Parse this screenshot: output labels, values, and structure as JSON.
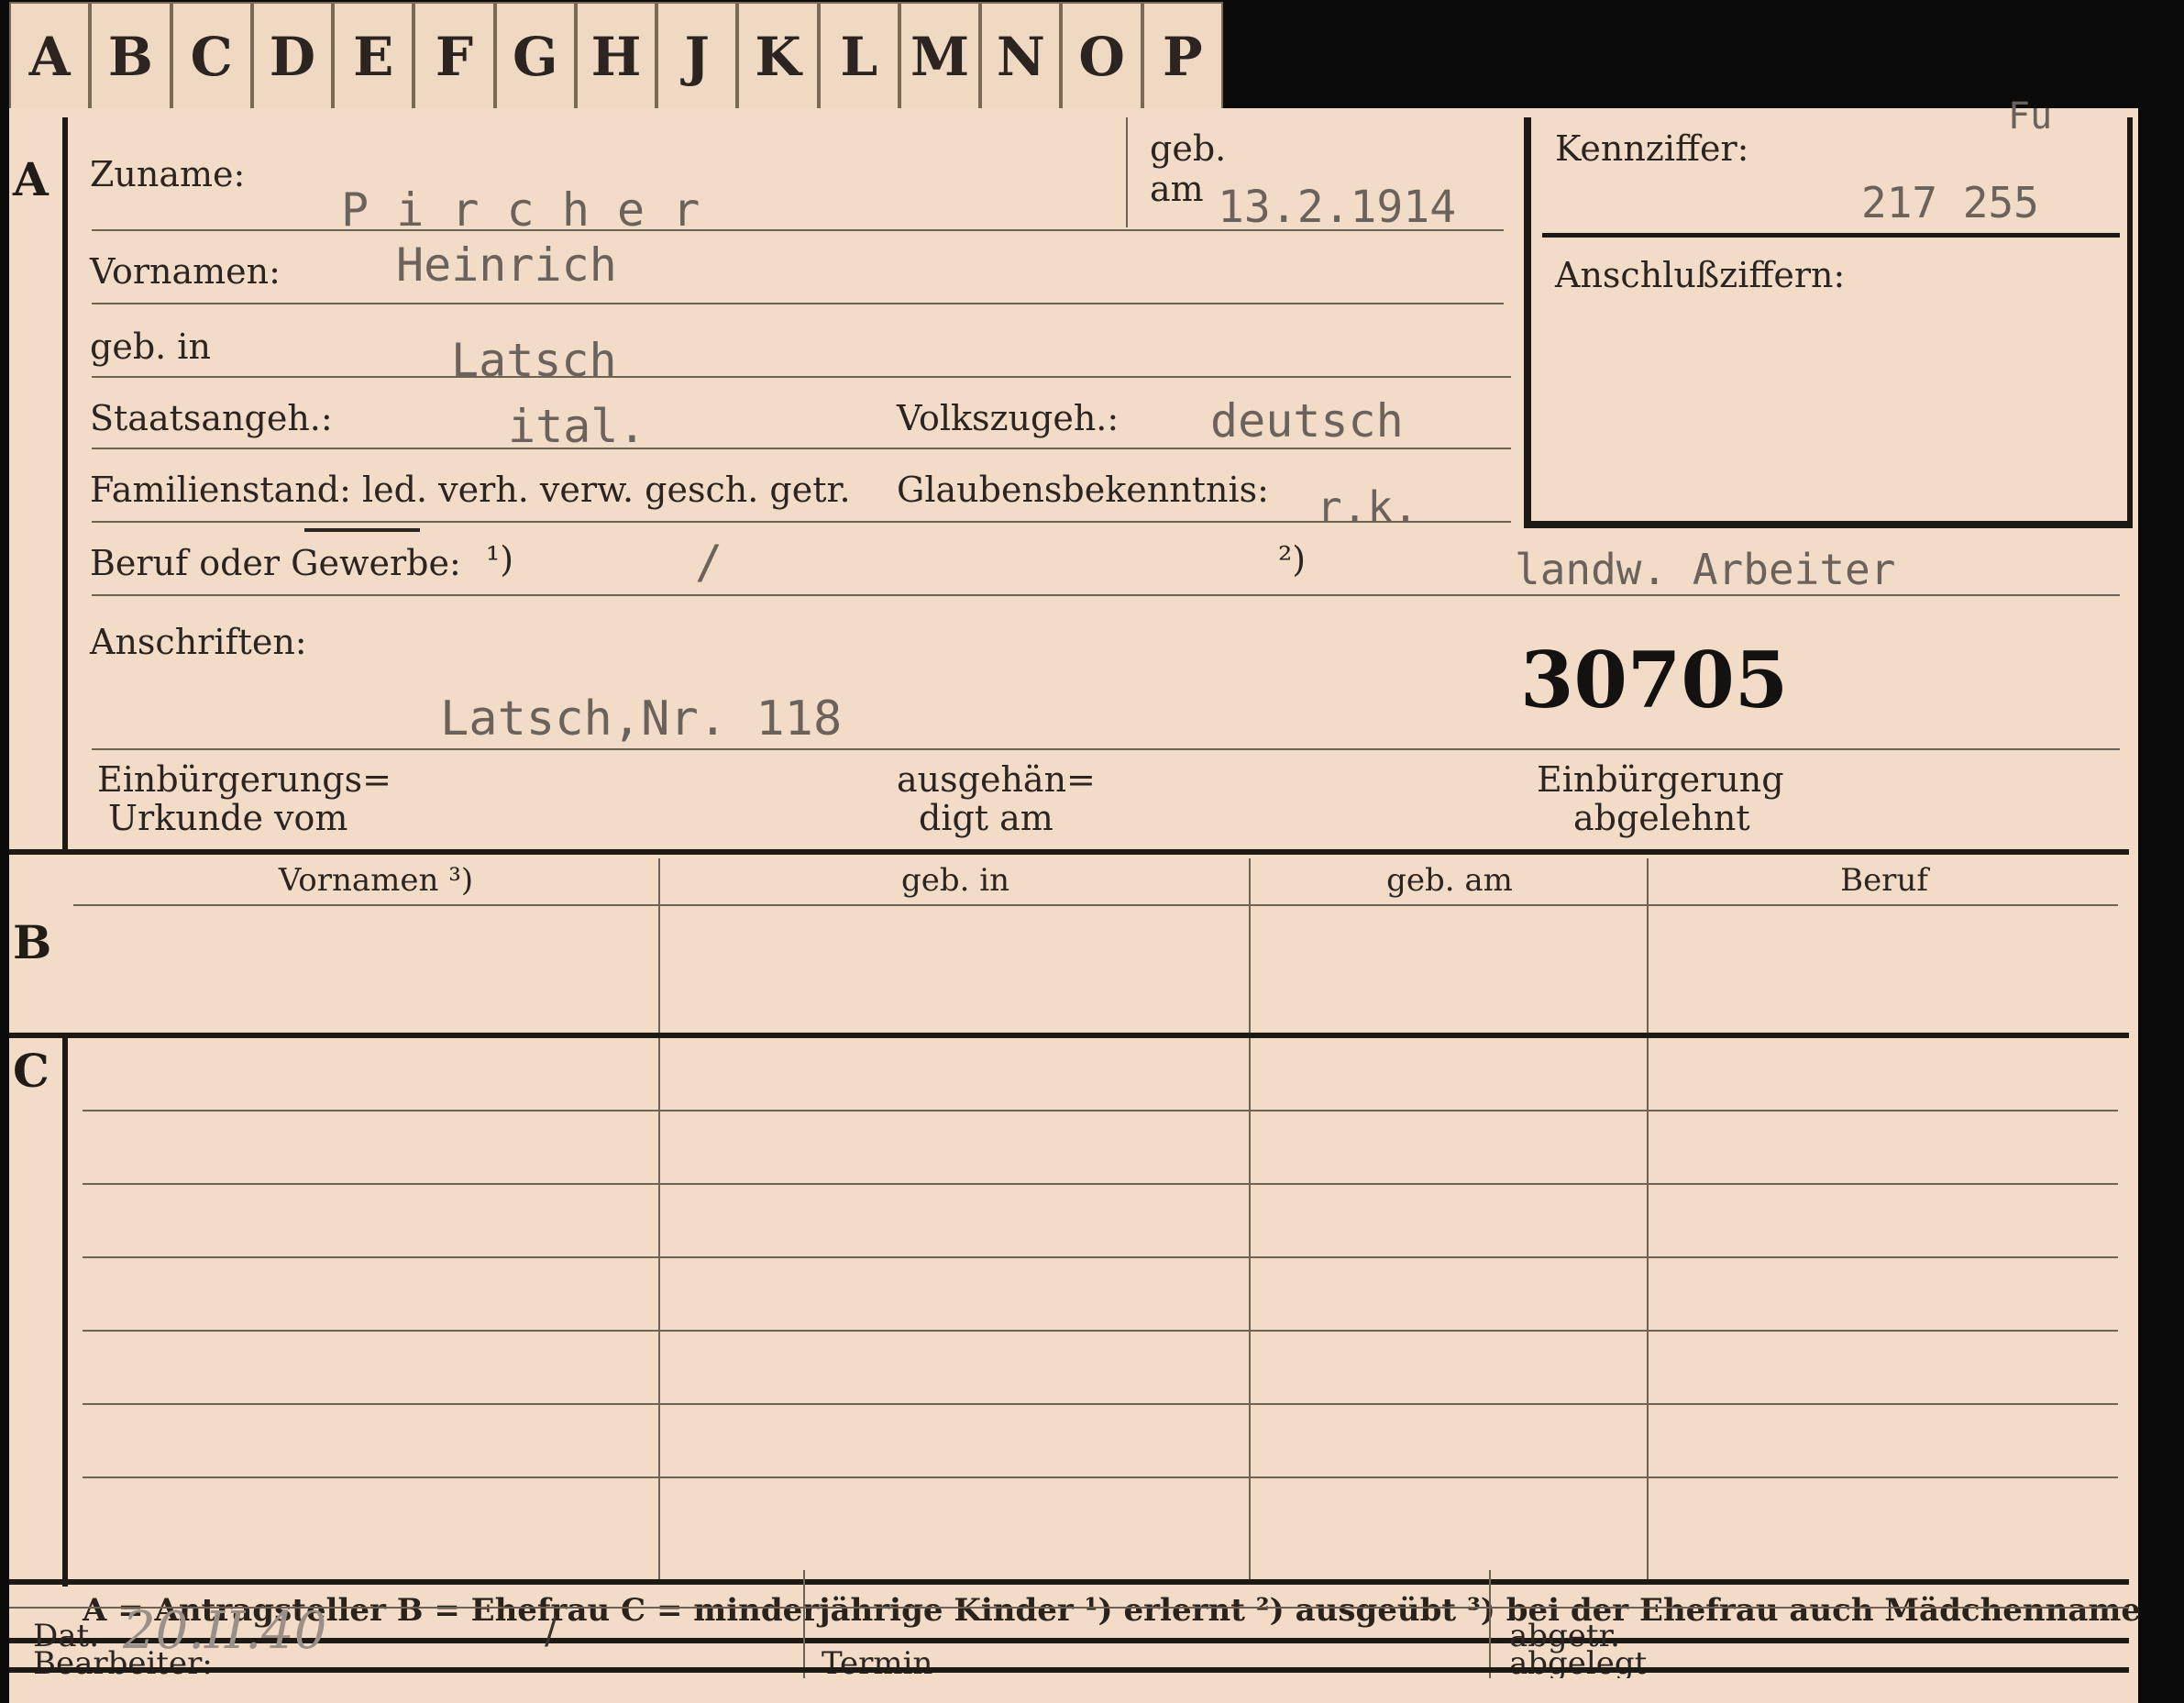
{
  "tabs": [
    "A",
    "B",
    "C",
    "D",
    "E",
    "F",
    "G",
    "H",
    "J",
    "K",
    "L",
    "M",
    "N",
    "O",
    "P"
  ],
  "section_letters": {
    "a": "A",
    "b": "B",
    "c": "C"
  },
  "labels": {
    "zuname": "Zuname:",
    "geb": "geb.",
    "am": "am",
    "kennziffer": "Kennziffer:",
    "vornamen": "Vornamen:",
    "anschluss": "Anschlußziffern:",
    "geb_in": "geb. in",
    "staatsangeh": "Staatsangeh.:",
    "volkszugeh": "Volkszugeh.:",
    "familienstand": "Familienstand: led. verh. verw. gesch. getr.",
    "glaubens": "Glaubensbekenntnis:",
    "beruf": "Beruf oder Gewerbe:",
    "beruf_fn1": "¹)",
    "beruf_fn2": "²)",
    "anschriften": "Anschriften:",
    "einb_urkunde_1": "Einbürgerungs=",
    "einb_urkunde_2": "Urkunde vom",
    "ausgehaendigt_1": "ausgehän=",
    "ausgehaendigt_2": "digt am",
    "einb_abgelehnt_1": "Einbürgerung",
    "einb_abgelehnt_2": "abgelehnt",
    "bearbeiter": "Bearbeiter:",
    "dat": "Dat.",
    "termin": "Termin",
    "abgelegt": "abgelegt",
    "abgetr": "abgetr."
  },
  "values": {
    "zuname": "P i r c h e r",
    "geb_am": "13.2.1914",
    "kennziffer_top": "Fu",
    "kennziffer": "217 255",
    "vornamen": "Heinrich",
    "geb_in": "Latsch",
    "staatsangeh": "ital.",
    "volkszugeh": "deutsch",
    "glaubens": "r.k.",
    "beruf_1": "/",
    "beruf_2": "landw. Arbeiter",
    "anschrift": "Latsch,Nr. 118",
    "stamp_number": "30705",
    "datum": "20.II.40",
    "datum_slash": "/"
  },
  "section_b_headers": [
    "Vornamen ³)",
    "geb. in",
    "geb. am",
    "Beruf"
  ],
  "legend": "A = Antragsteller   B = Ehefrau   C = minderjährige Kinder   ¹) erlernt   ²) ausgeübt   ³) bei der Ehefrau auch Mädchenname",
  "colors": {
    "card": "#f2dcc7",
    "ink": "#2b2420",
    "typed": "#6b625c",
    "border": "#1d1a16"
  }
}
